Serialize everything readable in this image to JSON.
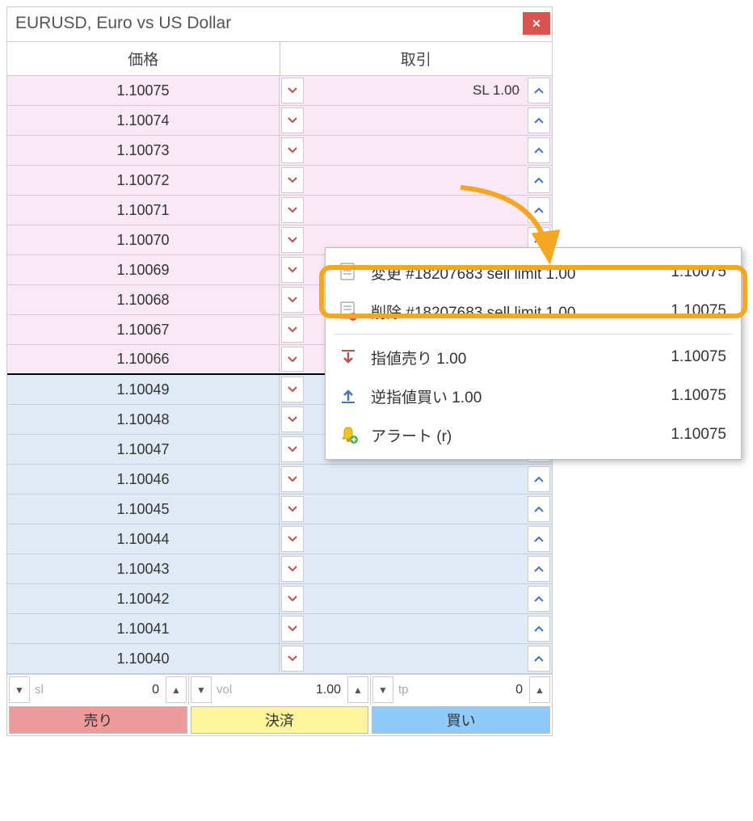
{
  "title": "EURUSD, Euro vs US Dollar",
  "headers": {
    "price": "価格",
    "trade": "取引"
  },
  "rows": [
    {
      "price": "1.10075",
      "label": "SL 1.00",
      "zone": "pink"
    },
    {
      "price": "1.10074",
      "label": "",
      "zone": "pink"
    },
    {
      "price": "1.10073",
      "label": "",
      "zone": "pink"
    },
    {
      "price": "1.10072",
      "label": "",
      "zone": "pink"
    },
    {
      "price": "1.10071",
      "label": "",
      "zone": "pink"
    },
    {
      "price": "1.10070",
      "label": "",
      "zone": "pink"
    },
    {
      "price": "1.10069",
      "label": "",
      "zone": "pink"
    },
    {
      "price": "1.10068",
      "label": "",
      "zone": "pink"
    },
    {
      "price": "1.10067",
      "label": "",
      "zone": "pink"
    },
    {
      "price": "1.10066",
      "label": "",
      "zone": "pink",
      "divider": true
    },
    {
      "price": "1.10049",
      "label": "",
      "zone": "blue"
    },
    {
      "price": "1.10048",
      "label": "",
      "zone": "blue"
    },
    {
      "price": "1.10047",
      "label": "",
      "zone": "blue"
    },
    {
      "price": "1.10046",
      "label": "",
      "zone": "blue"
    },
    {
      "price": "1.10045",
      "label": "",
      "zone": "blue"
    },
    {
      "price": "1.10044",
      "label": "",
      "zone": "blue"
    },
    {
      "price": "1.10043",
      "label": "",
      "zone": "blue"
    },
    {
      "price": "1.10042",
      "label": "",
      "zone": "blue"
    },
    {
      "price": "1.10041",
      "label": "",
      "zone": "blue"
    },
    {
      "price": "1.10040",
      "label": "",
      "zone": "blue"
    }
  ],
  "inputs": {
    "sl": {
      "label": "sl",
      "value": "0"
    },
    "vol": {
      "label": "vol",
      "value": "1.00"
    },
    "tp": {
      "label": "tp",
      "value": "0"
    }
  },
  "buttons": {
    "sell": "売り",
    "settle": "決済",
    "buy": "買い"
  },
  "ctx": {
    "items": [
      {
        "icon": "doc",
        "label": "変更 #18207683 sell limit 1.00",
        "price": "1.10075"
      },
      {
        "icon": "doc-x",
        "label": "削除 #18207683 sell limit 1.00",
        "price": "1.10075"
      },
      {
        "sep": true
      },
      {
        "icon": "down",
        "label": "指値売り 1.00",
        "price": "1.10075"
      },
      {
        "icon": "up",
        "label": "逆指値買い 1.00",
        "price": "1.10075"
      },
      {
        "icon": "bell",
        "label": "アラート (r)",
        "price": "1.10075"
      }
    ]
  }
}
